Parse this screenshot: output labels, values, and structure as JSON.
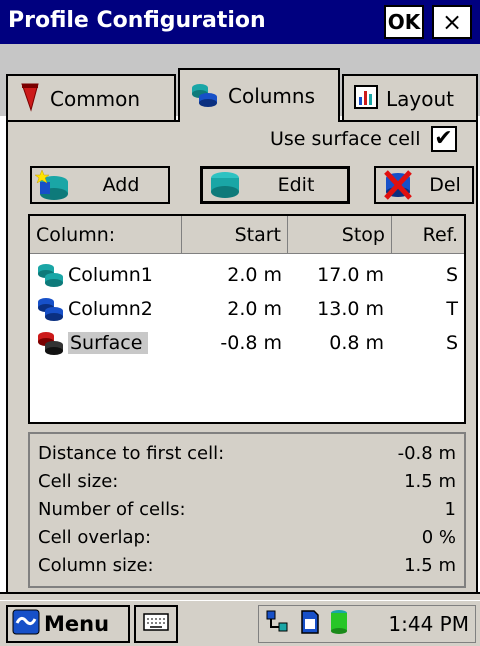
{
  "window": {
    "title": "Profile Configuration",
    "ok_label": "OK",
    "close_label": "×"
  },
  "tabs": [
    {
      "label": "Common",
      "icon": "red-marker-icon"
    },
    {
      "label": "Columns",
      "icon": "columns-icon",
      "active": true
    },
    {
      "label": "Layout",
      "icon": "layout-icon"
    }
  ],
  "options": {
    "use_surface_cell_label": "Use surface cell",
    "use_surface_cell_checked": "✔"
  },
  "buttons": {
    "add": "Add",
    "edit": "Edit",
    "del": "Del"
  },
  "table": {
    "headers": [
      "Column:",
      "Start",
      "Stop",
      "Ref."
    ],
    "rows": [
      {
        "name": "Column1",
        "start": "2.0 m",
        "stop": "17.0 m",
        "ref": "S"
      },
      {
        "name": "Column2",
        "start": "2.0 m",
        "stop": "13.0 m",
        "ref": "T"
      },
      {
        "name": "Surface",
        "start": "-0.8 m",
        "stop": "0.8 m",
        "ref": "S",
        "selected": true
      }
    ]
  },
  "info": [
    {
      "label": "Distance to first cell:",
      "value": "-0.8 m"
    },
    {
      "label": "Cell size:",
      "value": "1.5 m"
    },
    {
      "label": "Number of cells:",
      "value": "1"
    },
    {
      "label": "Cell overlap:",
      "value": "0 %"
    },
    {
      "label": "Column size:",
      "value": "1.5 m"
    }
  ],
  "taskbar": {
    "menu_label": "Menu",
    "clock": "1:44 PM"
  },
  "colors": {
    "titlebar": "#00007f",
    "teal": "#1aa6a6",
    "blue": "#1750c8",
    "red": "#cc1a1a"
  }
}
